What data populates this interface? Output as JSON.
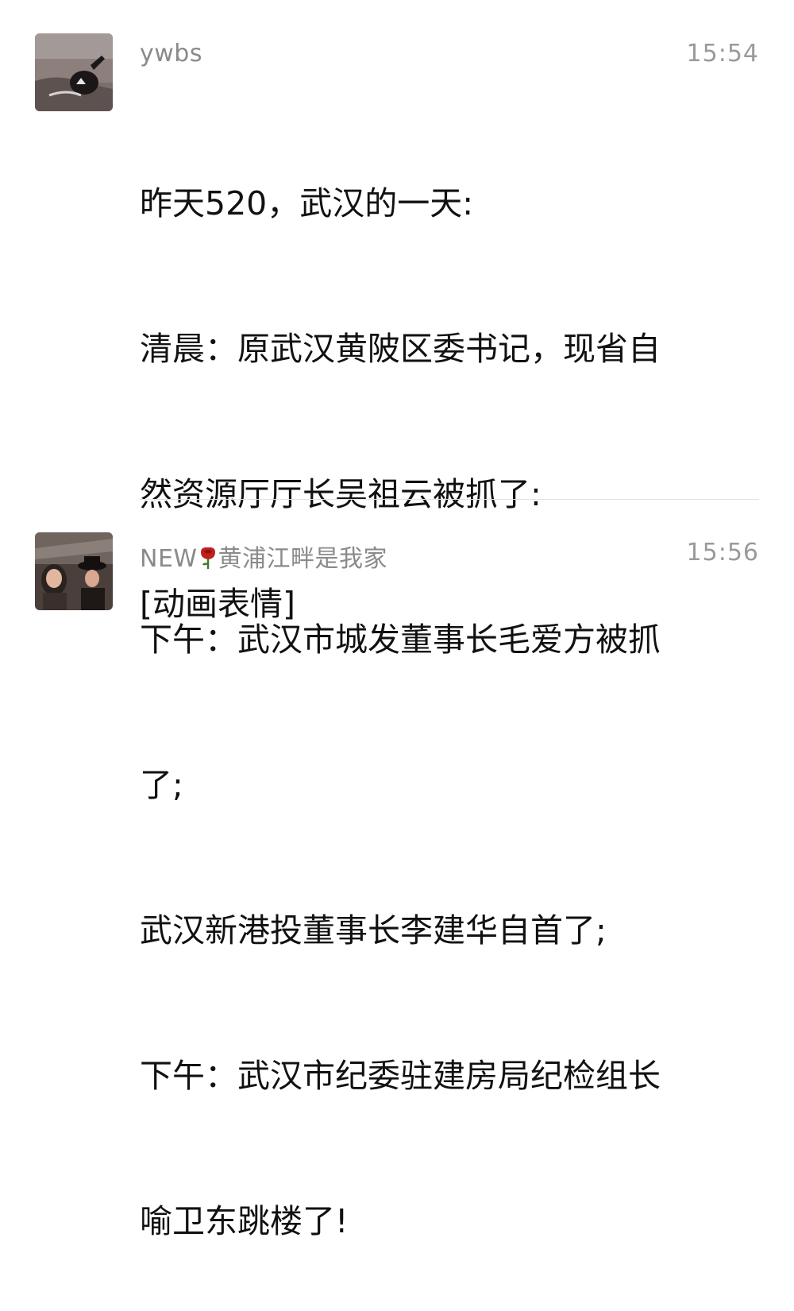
{
  "messages": [
    {
      "sender": "ywbs",
      "time": "15:54",
      "avatar_icon": "photo-avatar-icon",
      "lines": [
        "昨天520，武汉的一天:",
        "清晨：原武汉黄陂区委书记，现省自",
        "然资源厅厅长吴祖云被抓了:",
        "下午：武汉市城发董事长毛爱方被抓",
        "了;",
        "武汉新港投董事长李建华自首了;",
        "下午：武汉市纪委驻建房局纪检组长",
        "喻卫东跳楼了!"
      ]
    },
    {
      "sender_prefix": "NEW",
      "sender_icon": "rose-icon",
      "sender_suffix": "黄浦江畔是我家",
      "time": "15:56",
      "avatar_icon": "photo-avatar-icon",
      "body": "[动画表情]"
    }
  ]
}
